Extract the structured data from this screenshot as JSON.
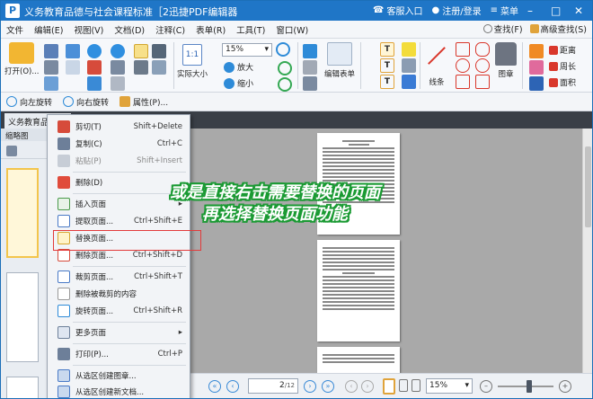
{
  "window": {
    "title": "义务教育品德与社会课程标准［2迅捷PDF编辑器",
    "app_icon": "P",
    "register_label": "客服入口",
    "login_label": "注册/登录",
    "menu_label": "菜单",
    "accent": "#1f76c7"
  },
  "menu": {
    "items": [
      "文件",
      "编辑(E)",
      "视图(V)",
      "文档(D)",
      "注释(C)",
      "表单(R)",
      "工具(T)",
      "窗口(W)"
    ],
    "find_label": "查找(F)",
    "advanced_find_label": "高级查找(S)"
  },
  "toolbar": {
    "open_label": "打开(O)...",
    "zoom_value": "15%",
    "zoom_in_label": "放大",
    "zoom_out_label": "缩小",
    "actual_size_label": "实际大小",
    "edit_content_label": "编辑表单",
    "line_label": "线条",
    "stamp_label": "图章",
    "distance_label": "距离",
    "perimeter_label": "周长",
    "area_label": "面积"
  },
  "subtoolbar": {
    "rotate_left": "向左旋转",
    "rotate_right": "向右旋转",
    "properties": "属性(P)..."
  },
  "tab": {
    "label": "义务教育品德"
  },
  "left_pane": {
    "header": "缩略图"
  },
  "context_menu": {
    "items": [
      {
        "label": "剪切(T)",
        "shortcut": "Shift+Delete"
      },
      {
        "label": "复制(C)",
        "shortcut": "Ctrl+C"
      },
      {
        "label": "粘贴(P)",
        "shortcut": "Shift+Insert"
      },
      {
        "label": "删除(D)",
        "shortcut": ""
      },
      {
        "label": "插入页面",
        "shortcut": ""
      },
      {
        "label": "提取页面...",
        "shortcut": "Ctrl+Shift+E"
      },
      {
        "label": "替换页面...",
        "shortcut": ""
      },
      {
        "label": "删除页面...",
        "shortcut": "Ctrl+Shift+D"
      },
      {
        "label": "裁剪页面...",
        "shortcut": "Ctrl+Shift+T"
      },
      {
        "label": "删除被裁剪的内容",
        "shortcut": ""
      },
      {
        "label": "旋转页面...",
        "shortcut": "Ctrl+Shift+R"
      },
      {
        "label": "更多页面",
        "shortcut": ""
      },
      {
        "label": "打印(P)...",
        "shortcut": "Ctrl+P"
      },
      {
        "label": "从选区创建图章...",
        "shortcut": ""
      },
      {
        "label": "从选区创建新文档...",
        "shortcut": ""
      }
    ]
  },
  "annotation": {
    "line1": "或是直接右击需要替换的页面",
    "line2": "再选择替换页面功能"
  },
  "status": {
    "page_input": "2",
    "page_total": "/12",
    "zoom": "15%"
  }
}
